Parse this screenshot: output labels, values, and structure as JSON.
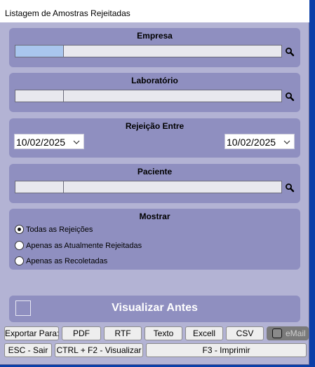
{
  "window": {
    "title": "Listagem de Amostras Rejeitadas"
  },
  "empresa": {
    "title": "Empresa",
    "code": "",
    "description": ""
  },
  "laboratorio": {
    "title": "Laboratório",
    "code": "",
    "description": ""
  },
  "rejeicao": {
    "title": "Rejeição Entre",
    "date_from": "10/02/2025",
    "date_to": "10/02/2025"
  },
  "paciente": {
    "title": "Paciente",
    "code": "",
    "description": ""
  },
  "mostrar": {
    "title": "Mostrar",
    "options": [
      "Todas as Rejeições",
      "Apenas as Atualmente Rejeitadas",
      "Apenas as Recoletadas"
    ],
    "selected": "Todas as Rejeições"
  },
  "visualizar_antes": {
    "label": "Visualizar Antes",
    "checked": false
  },
  "export": {
    "label": "Exportar Para:",
    "buttons": [
      "PDF",
      "RTF",
      "Texto",
      "Excell",
      "CSV"
    ],
    "email_label": "eMail"
  },
  "actions": {
    "exit": "ESC - Sair",
    "preview": "CTRL + F2 - Visualizar",
    "print": "F3 - Imprimir"
  },
  "colors": {
    "panel": "#8f8fc0",
    "window": "#b3b3d4",
    "desktop": "#0a3fa8",
    "selected_field": "#a9c6ee"
  },
  "icons": {
    "lookup": "search-icon",
    "date_dropdown": "chevron-down-icon",
    "email": "checkbox-icon"
  }
}
